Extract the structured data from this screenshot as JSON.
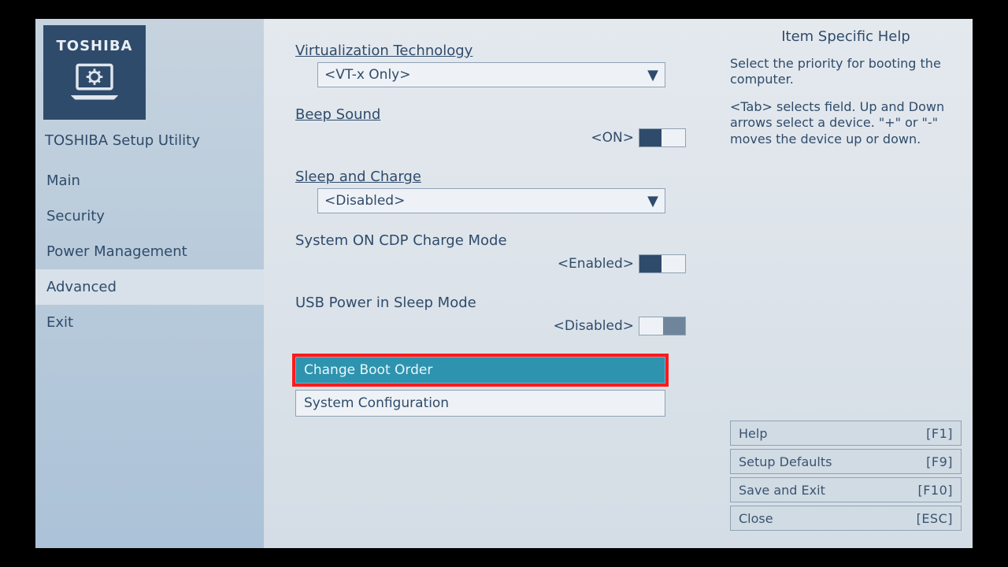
{
  "brand": {
    "name": "TOSHIBA"
  },
  "utility_title": "TOSHIBA Setup Utility",
  "nav": {
    "items": [
      {
        "label": "Main"
      },
      {
        "label": "Security"
      },
      {
        "label": "Power Management"
      },
      {
        "label": "Advanced",
        "selected": true
      },
      {
        "label": "Exit"
      }
    ]
  },
  "settings": {
    "virtualization": {
      "label": "Virtualization Technology",
      "value": "<VT-x Only>"
    },
    "beep": {
      "label": "Beep Sound",
      "value": "<ON>"
    },
    "sleep_charge": {
      "label": "Sleep and Charge",
      "value": "<Disabled>"
    },
    "cdp_charge": {
      "label": "System ON CDP Charge Mode",
      "value": "<Enabled>"
    },
    "usb_sleep": {
      "label": "USB Power in Sleep Mode",
      "value": "<Disabled>"
    }
  },
  "submenus": {
    "change_boot_order": {
      "label": "Change Boot Order"
    },
    "system_configuration": {
      "label": "System Configuration"
    }
  },
  "help": {
    "title": "Item Specific Help",
    "p1": "Select the priority for booting the computer.",
    "p2": "<Tab> selects field. Up and Down arrows select a device. \"+\" or \"-\" moves the device up or down."
  },
  "fkeys": {
    "help": {
      "label": "Help",
      "key": "[F1]"
    },
    "default": {
      "label": "Setup Defaults",
      "key": "[F9]"
    },
    "save": {
      "label": "Save and Exit",
      "key": "[F10]"
    },
    "close": {
      "label": "Close",
      "key": "[ESC]"
    }
  }
}
